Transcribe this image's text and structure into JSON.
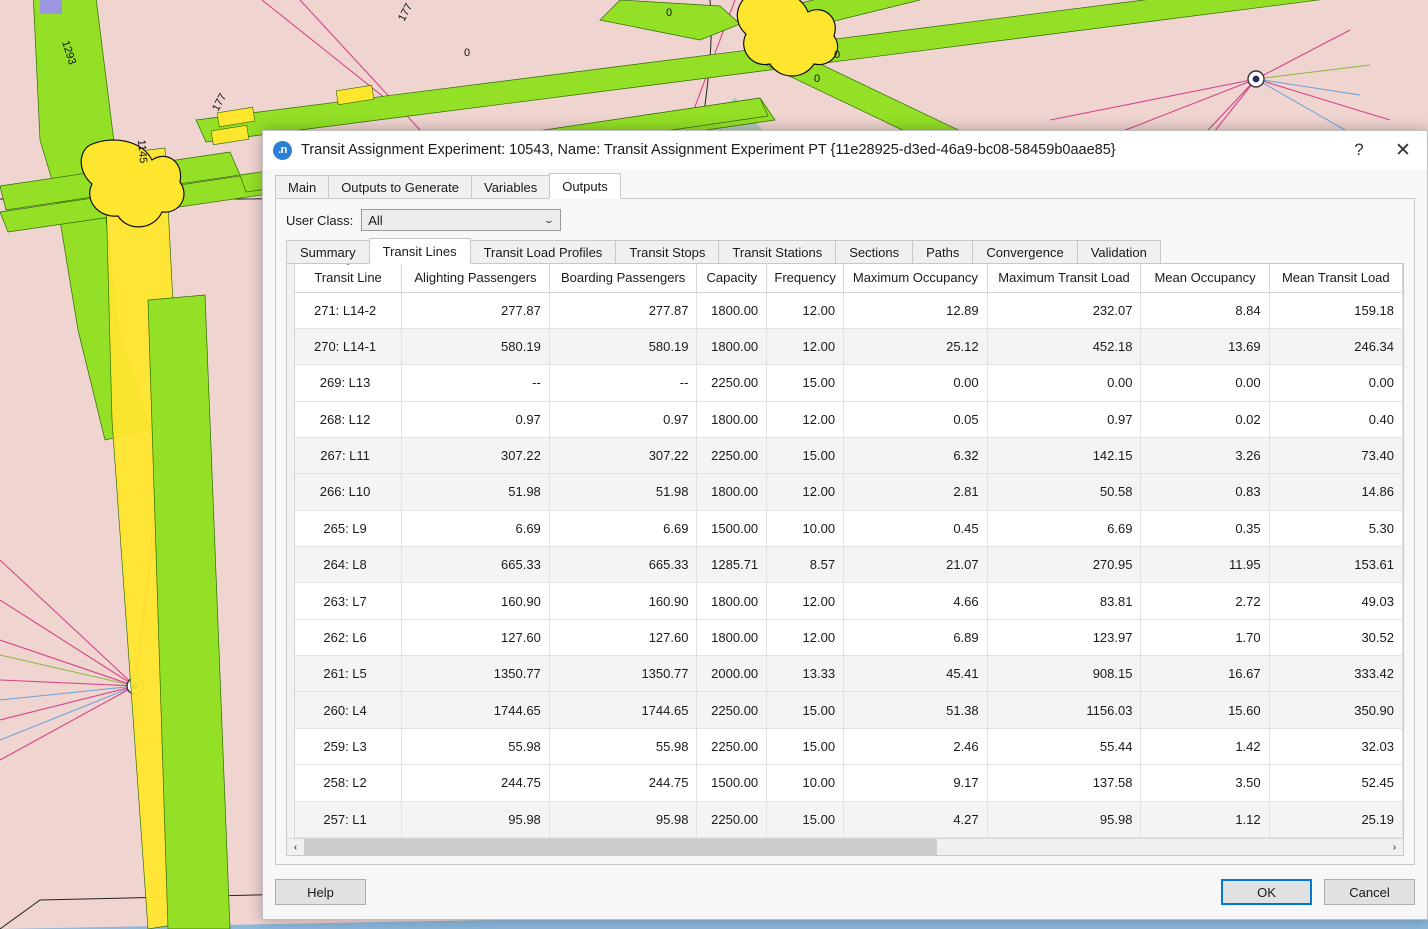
{
  "window": {
    "icon": "aimsun-app-icon",
    "title": "Transit Assignment Experiment: 10543, Name: Transit Assignment Experiment PT  {11e28925-d3ed-46a9-bc08-58459b0aae85}",
    "help_glyph": "?",
    "close_glyph": "✕"
  },
  "tabs": [
    {
      "label": "Main",
      "active": false
    },
    {
      "label": "Outputs to Generate",
      "active": false
    },
    {
      "label": "Variables",
      "active": false
    },
    {
      "label": "Outputs",
      "active": true
    }
  ],
  "user_class": {
    "label": "User Class:",
    "value": "All",
    "chevron": "⌄"
  },
  "subtabs": [
    {
      "label": "Summary",
      "active": false
    },
    {
      "label": "Transit Lines",
      "active": true
    },
    {
      "label": "Transit Load Profiles",
      "active": false
    },
    {
      "label": "Transit Stops",
      "active": false
    },
    {
      "label": "Transit Stations",
      "active": false
    },
    {
      "label": "Sections",
      "active": false
    },
    {
      "label": "Paths",
      "active": false
    },
    {
      "label": "Convergence",
      "active": false
    },
    {
      "label": "Validation",
      "active": false
    }
  ],
  "table": {
    "sort_column": "Transit Line",
    "columns": [
      "Transit Line",
      "Alighting Passengers",
      "Boarding Passengers",
      "Capacity",
      "Frequency",
      "Maximum Occupancy",
      "Maximum Transit Load",
      "Mean Occupancy",
      "Mean Transit Load"
    ],
    "rows": [
      [
        "271: L14-2",
        "277.87",
        "277.87",
        "1800.00",
        "12.00",
        "12.89",
        "232.07",
        "8.84",
        "159.18"
      ],
      [
        "270: L14-1",
        "580.19",
        "580.19",
        "1800.00",
        "12.00",
        "25.12",
        "452.18",
        "13.69",
        "246.34"
      ],
      [
        "269: L13",
        "--",
        "--",
        "2250.00",
        "15.00",
        "0.00",
        "0.00",
        "0.00",
        "0.00"
      ],
      [
        "268: L12",
        "0.97",
        "0.97",
        "1800.00",
        "12.00",
        "0.05",
        "0.97",
        "0.02",
        "0.40"
      ],
      [
        "267: L11",
        "307.22",
        "307.22",
        "2250.00",
        "15.00",
        "6.32",
        "142.15",
        "3.26",
        "73.40"
      ],
      [
        "266: L10",
        "51.98",
        "51.98",
        "1800.00",
        "12.00",
        "2.81",
        "50.58",
        "0.83",
        "14.86"
      ],
      [
        "265: L9",
        "6.69",
        "6.69",
        "1500.00",
        "10.00",
        "0.45",
        "6.69",
        "0.35",
        "5.30"
      ],
      [
        "264: L8",
        "665.33",
        "665.33",
        "1285.71",
        "8.57",
        "21.07",
        "270.95",
        "11.95",
        "153.61"
      ],
      [
        "263: L7",
        "160.90",
        "160.90",
        "1800.00",
        "12.00",
        "4.66",
        "83.81",
        "2.72",
        "49.03"
      ],
      [
        "262: L6",
        "127.60",
        "127.60",
        "1800.00",
        "12.00",
        "6.89",
        "123.97",
        "1.70",
        "30.52"
      ],
      [
        "261: L5",
        "1350.77",
        "1350.77",
        "2000.00",
        "13.33",
        "45.41",
        "908.15",
        "16.67",
        "333.42"
      ],
      [
        "260: L4",
        "1744.65",
        "1744.65",
        "2250.00",
        "15.00",
        "51.38",
        "1156.03",
        "15.60",
        "350.90"
      ],
      [
        "259: L3",
        "55.98",
        "55.98",
        "2250.00",
        "15.00",
        "2.46",
        "55.44",
        "1.42",
        "32.03"
      ],
      [
        "258: L2",
        "244.75",
        "244.75",
        "1500.00",
        "10.00",
        "9.17",
        "137.58",
        "3.50",
        "52.45"
      ],
      [
        "257: L1",
        "95.98",
        "95.98",
        "2250.00",
        "15.00",
        "4.27",
        "95.98",
        "1.12",
        "25.19"
      ]
    ]
  },
  "hscrollbar": {
    "left_arrow": "‹",
    "right_arrow": "›"
  },
  "footer": {
    "help": "Help",
    "ok": "OK",
    "cancel": "Cancel"
  },
  "map": {
    "labels": [
      "1293",
      "177",
      "0",
      "0",
      "0",
      "1145",
      "0",
      "0"
    ],
    "colors": {
      "background": "#f0d4d0",
      "road": "#93e026",
      "node": "#ffe62e",
      "centroid_link": "#d4458a",
      "water": "#8cb8dd",
      "zone": "#9cc8b4"
    }
  }
}
